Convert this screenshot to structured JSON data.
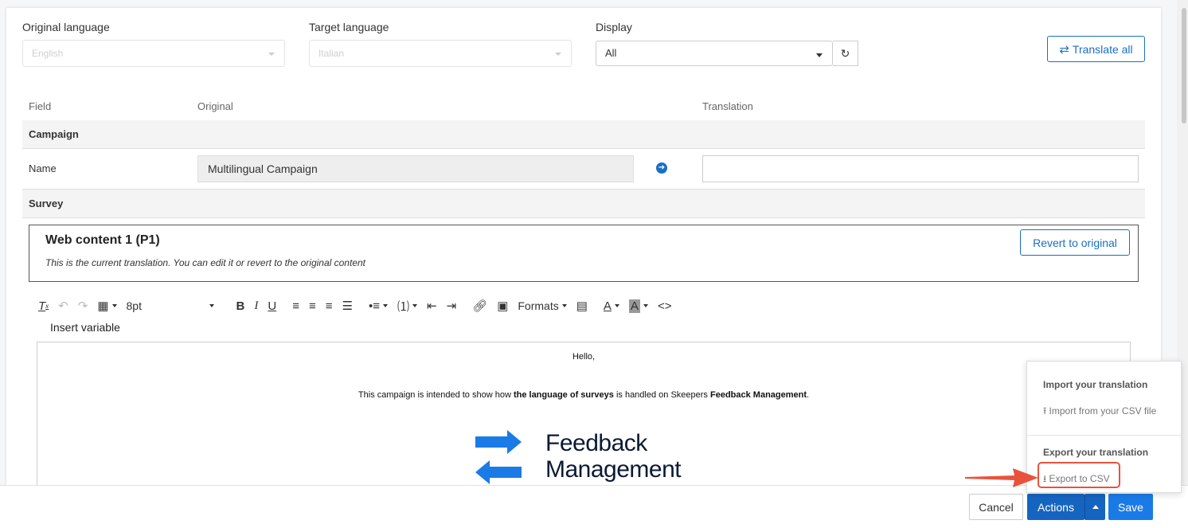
{
  "filters": {
    "original_language_label": "Original language",
    "original_language_value": "English",
    "target_language_label": "Target language",
    "target_language_value": "Italian",
    "display_label": "Display",
    "display_value": "All",
    "translate_all_label": "Translate all"
  },
  "table": {
    "headers": {
      "field": "Field",
      "original": "Original",
      "translation": "Translation"
    },
    "sections": [
      {
        "title": "Campaign",
        "rows": [
          {
            "field": "Name",
            "original": "Multilingual Campaign",
            "translation": ""
          }
        ]
      },
      {
        "title": "Survey"
      }
    ]
  },
  "web_content": {
    "title": "Web content 1 (P1)",
    "subtitle": "This is the current translation. You can edit it or revert to the original content",
    "revert_label": "Revert to original"
  },
  "toolbar": {
    "font_size": "8pt",
    "formats_label": "Formats",
    "insert_variable_label": "Insert variable"
  },
  "editor": {
    "greeting": "Hello,",
    "body_pre": "This campaign is intended to show how ",
    "body_bold1": "the language of surveys",
    "body_mid": " is handled on Skeepers ",
    "body_bold2": "Feedback Management",
    "body_post": ".",
    "logo_line1": "Feedback",
    "logo_line2": "Management"
  },
  "actions_menu": {
    "import_heading": "Import your translation",
    "import_item": "Import from your CSV file",
    "export_heading": "Export your translation",
    "export_item": "Export to CSV"
  },
  "footer": {
    "cancel_label": "Cancel",
    "actions_label": "Actions",
    "save_label": "Save"
  },
  "colors": {
    "primary": "#1565c0",
    "save": "#1a7be6",
    "highlight": "#e8533c",
    "logo_blue": "#1a7be6"
  }
}
